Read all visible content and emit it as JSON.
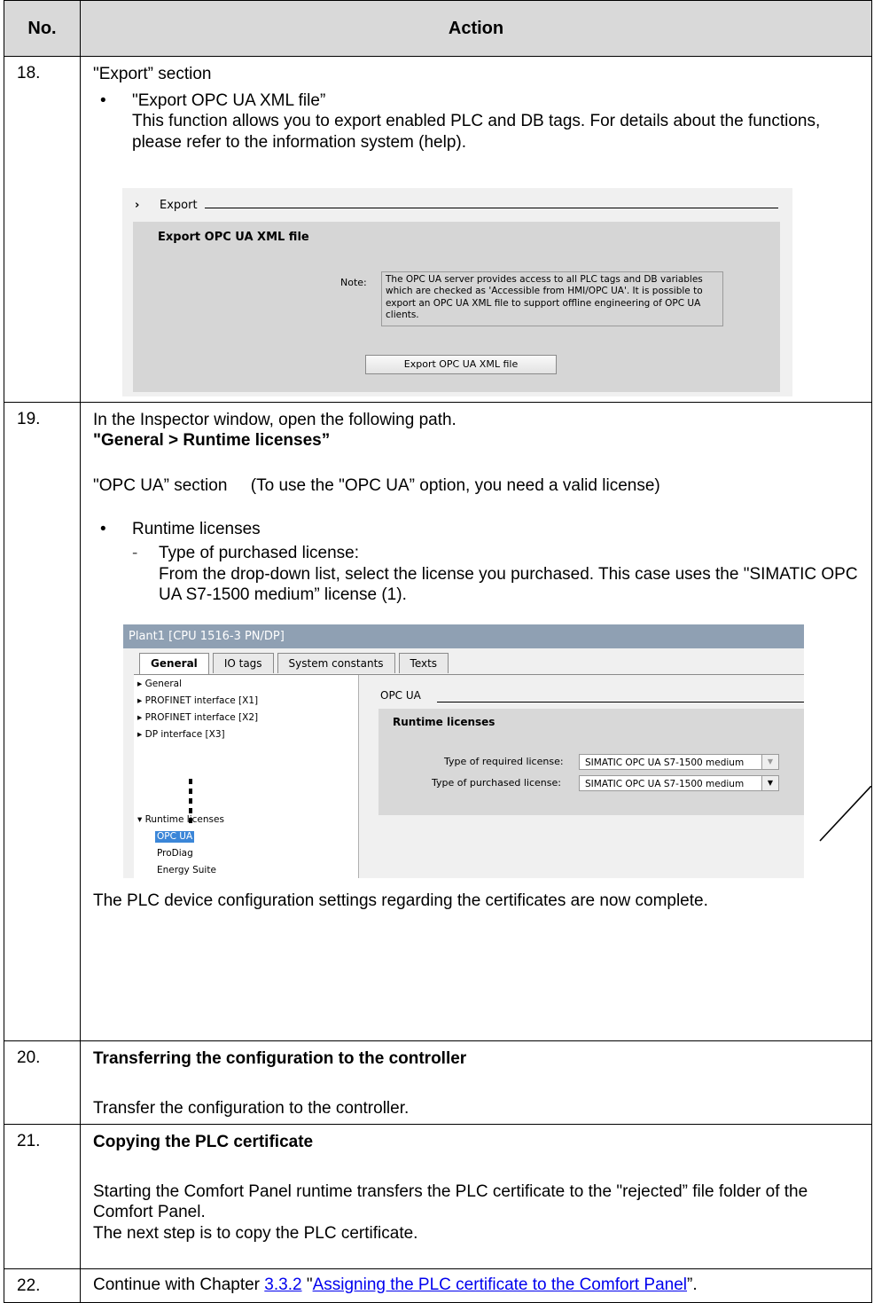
{
  "header": {
    "col_no": "No.",
    "col_action": "Action"
  },
  "step18": {
    "num": "18.",
    "section": "\"Export” section",
    "bullet_title": "\"Export OPC UA XML file”",
    "bullet_text": "This function allows you to export enabled PLC and DB tags. For details about the functions, please refer to the information system (help).",
    "shot": {
      "chevron": "›",
      "header": "Export",
      "sub_header": "Export OPC UA XML file",
      "note_label": "Note:",
      "note_text": "The OPC UA server provides access to all PLC tags and DB variables which are checked as 'Accessible from HMI/OPC UA'. It is possible to export an OPC UA XML file to support offline engineering of OPC UA clients.",
      "button": "Export OPC UA XML file"
    }
  },
  "step19": {
    "num": "19.",
    "line1": "In the Inspector window, open the following path.",
    "path": "\"General > Runtime licenses”",
    "section_line": "\"OPC UA” section     (To use the \"OPC UA” option, you need a valid license)",
    "bullet": "Runtime licenses",
    "sub_title": "Type of purchased license:",
    "sub_text": "From the drop-down list, select the license you purchased. This case uses the \"SIMATIC OPC UA S7-1500 medium” license (1).",
    "shot": {
      "title": "Plant1 [CPU 1516-3 PN/DP]",
      "tabs": [
        "General",
        "IO tags",
        "System constants",
        "Texts"
      ],
      "tree": [
        "General",
        "PROFINET interface [X1]",
        "PROFINET interface [X2]",
        "DP interface [X3]",
        "Runtime licenses",
        "OPC UA",
        "ProDiag",
        "Energy Suite"
      ],
      "section": "OPC UA",
      "sub_section": "Runtime licenses",
      "label_required": "Type of required license:",
      "label_purchased": "Type of purchased license:",
      "value_required": "SIMATIC OPC UA S7-1500 medium",
      "value_purchased": "SIMATIC OPC UA S7-1500 medium"
    },
    "conclusion": "The PLC device configuration settings regarding the certificates are now complete."
  },
  "step20": {
    "num": "20.",
    "title": "Transferring the configuration to the controller",
    "text": "Transfer the configuration to the controller."
  },
  "step21": {
    "num": "21.",
    "title": "Copying the PLC certificate",
    "text1": "Starting the Comfort Panel runtime transfers the PLC certificate to the \"rejected” file folder of the Comfort Panel.",
    "text2": "The next step is to copy the PLC certificate."
  },
  "step22": {
    "num": "22.",
    "prefix": "Continue with Chapter ",
    "chapter_link": "3.3.2",
    "middle": " \"",
    "title_link": "Assigning the PLC certificate to the Comfort Panel",
    "suffix": "”."
  }
}
